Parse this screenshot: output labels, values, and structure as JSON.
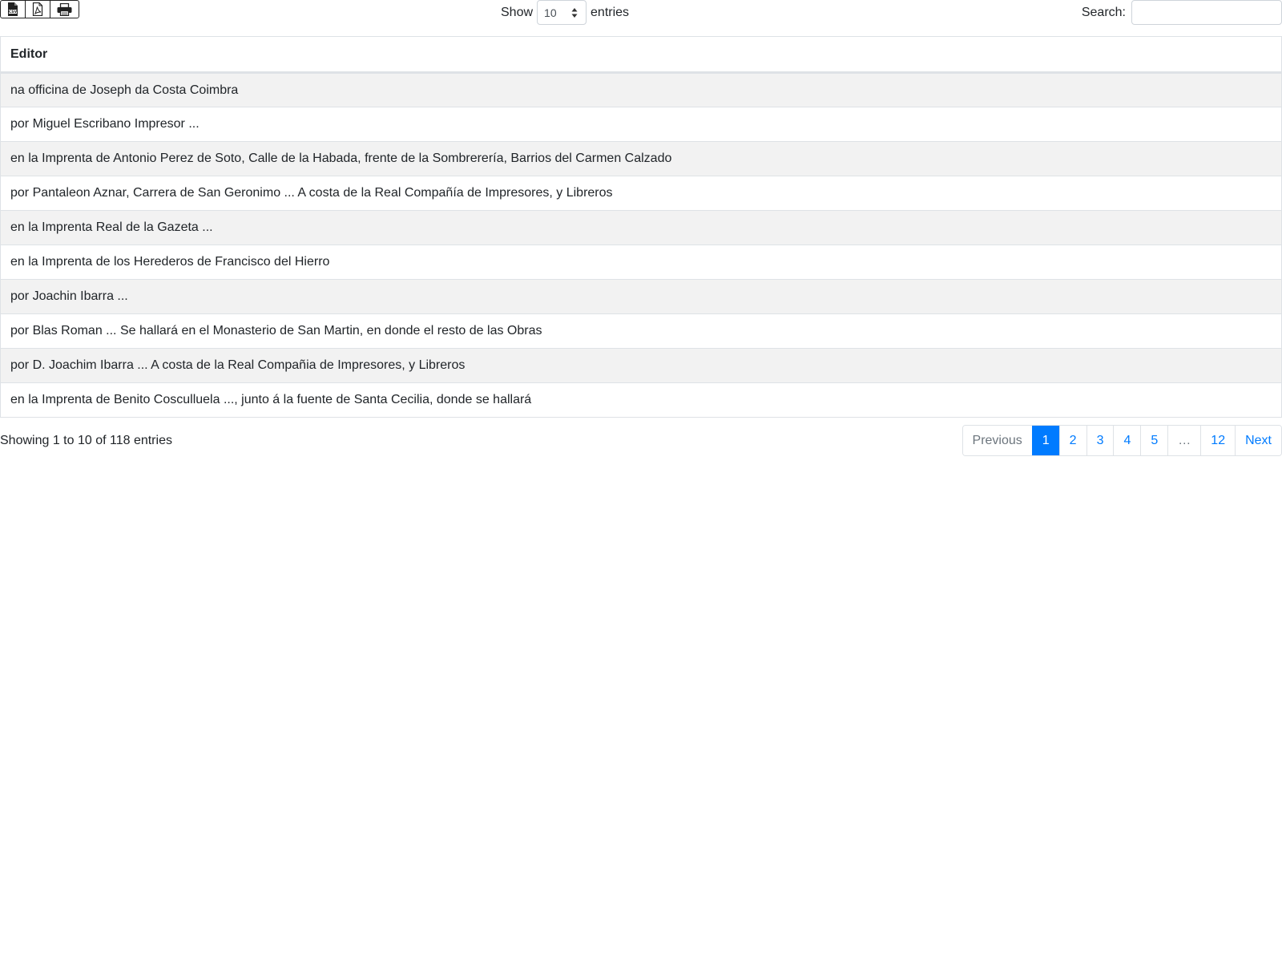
{
  "toolbar": {
    "buttons": [
      {
        "icon": "csv-file-icon",
        "label": "CSV"
      },
      {
        "icon": "pdf-file-icon",
        "label": ""
      },
      {
        "icon": "print-icon",
        "label": ""
      }
    ]
  },
  "length": {
    "show_label": "Show",
    "selected": "10",
    "entries_label": "entries"
  },
  "search": {
    "label": "Search:",
    "value": "",
    "placeholder": ""
  },
  "table": {
    "column": "Editor",
    "rows": [
      "na officina de Joseph da Costa Coimbra",
      "por Miguel Escribano Impresor ...",
      "en la Imprenta de Antonio Perez de Soto, Calle de la Habada, frente de la Sombrerería, Barrios del Carmen Calzado",
      "por Pantaleon Aznar, Carrera de San Geronimo ... A costa de la Real Compañía de Impresores, y Libreros",
      "en la Imprenta Real de la Gazeta ...",
      "en la Imprenta de los Herederos de Francisco del Hierro",
      "por Joachin Ibarra ...",
      "por Blas Roman ... Se hallará en el Monasterio de San Martin, en donde el resto de las Obras",
      "por D. Joachim Ibarra ... A costa de la Real Compañia de Impresores, y Libreros",
      "en la Imprenta de Benito Cosculluela ..., junto á la fuente de Santa Cecilia, donde se hallará"
    ]
  },
  "info": "Showing 1 to 10 of 118 entries",
  "pagination": {
    "previous": "Previous",
    "pages": [
      "1",
      "2",
      "3",
      "4",
      "5",
      "…",
      "12"
    ],
    "active": "1",
    "next": "Next"
  },
  "colors": {
    "accent": "#007bff",
    "stripe": "#f2f2f2",
    "border": "#dee2e6"
  }
}
